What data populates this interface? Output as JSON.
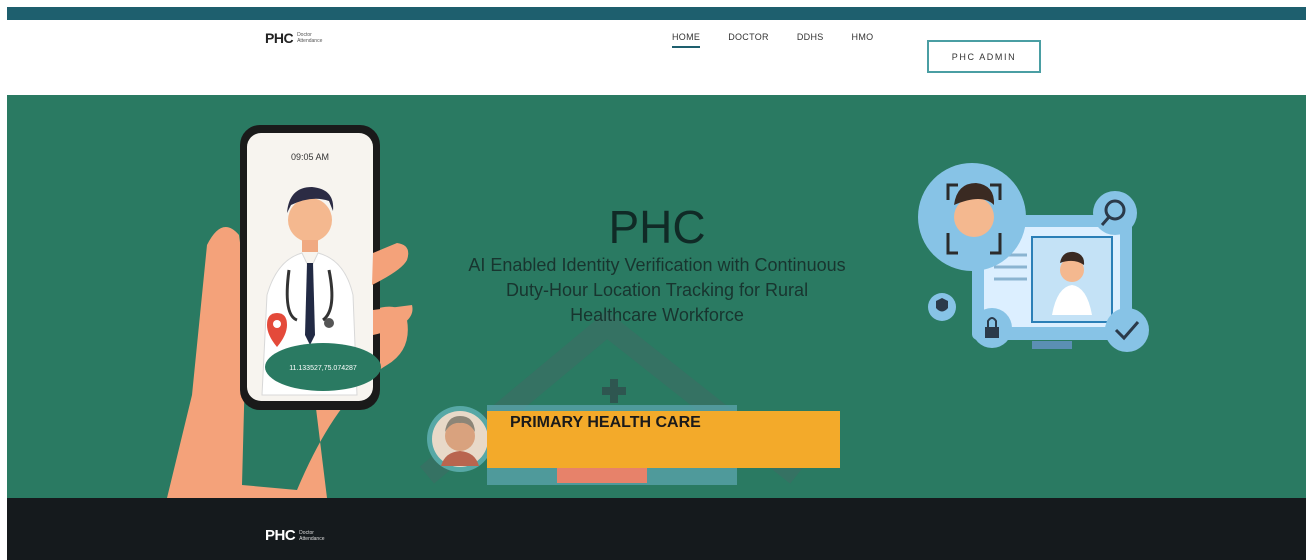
{
  "brand": {
    "logo": "PHC",
    "logo_sub_line1": "Doctor",
    "logo_sub_line2": "Attendance"
  },
  "nav": {
    "items": [
      {
        "label": "HOME",
        "active": true
      },
      {
        "label": "DOCTOR",
        "active": false
      },
      {
        "label": "DDHS",
        "active": false
      },
      {
        "label": "HMO",
        "active": false
      }
    ],
    "admin_button": "PHC ADMIN"
  },
  "hero": {
    "title": "PHC",
    "subtitle": "AI Enabled Identity Verification with Continuous Duty-Hour Location Tracking for Rural Healthcare Workforce",
    "phone_time": "09:05 AM",
    "phone_coords": "11.133527,75.074287",
    "banner_text": "PRIMARY HEALTH CARE"
  },
  "colors": {
    "topbar": "#1e5f6e",
    "hero_bg": "#2a7a62",
    "banner": "#f3aa2a",
    "footer": "#151a1d",
    "accent_blue": "#87c3e6"
  },
  "icons": [
    "location-pin-icon",
    "doctor-illustration",
    "face-scan-icon",
    "search-icon",
    "lock-icon",
    "shield-icon",
    "check-icon",
    "medical-cross-icon"
  ]
}
